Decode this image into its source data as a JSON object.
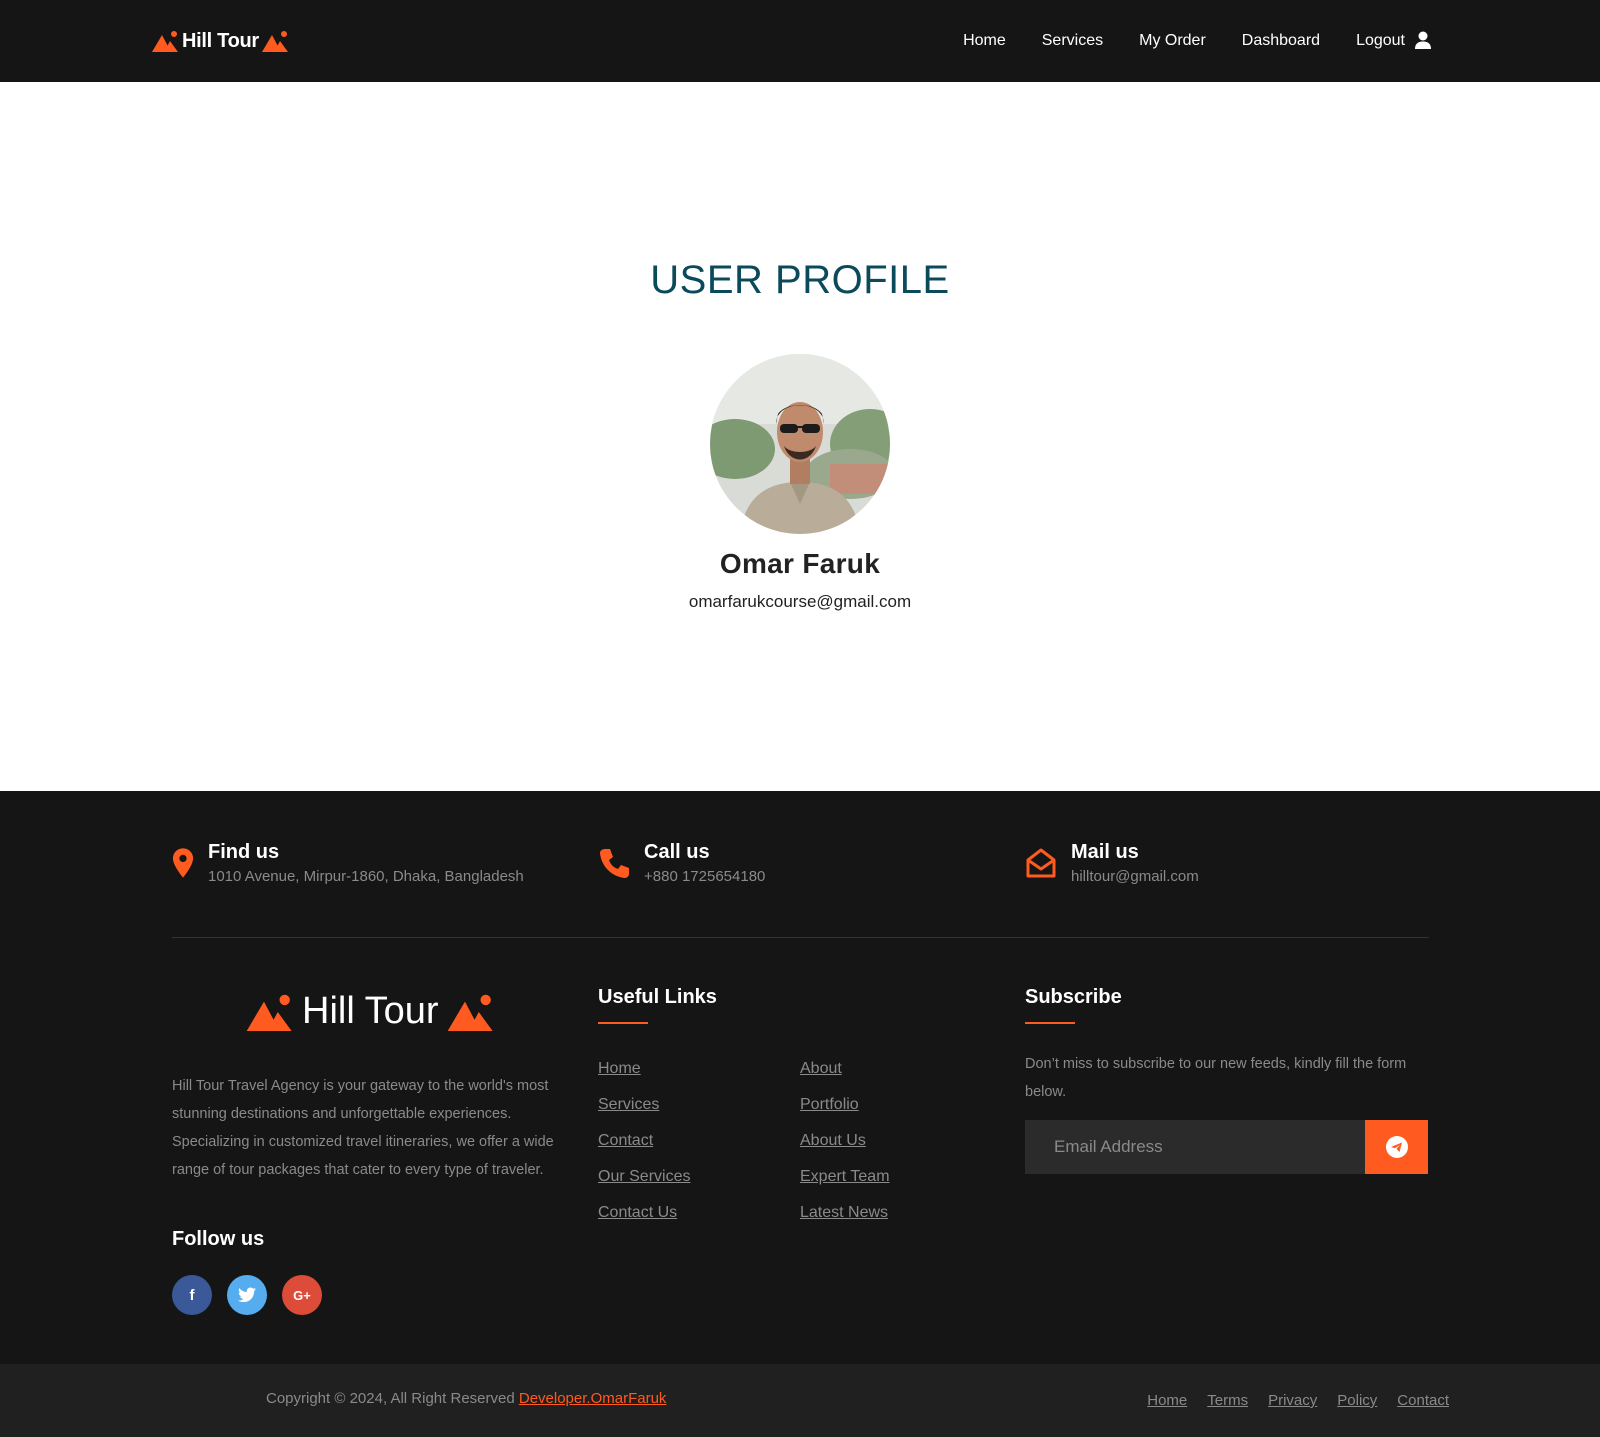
{
  "brand": {
    "name": "Hill Tour",
    "accent": "#ff5a1f",
    "logo_icon": "mountain-icon"
  },
  "nav": {
    "items": [
      {
        "label": "Home"
      },
      {
        "label": "Services"
      },
      {
        "label": "My Order"
      },
      {
        "label": "Dashboard"
      },
      {
        "label": "Logout"
      }
    ],
    "user_icon": "user-icon"
  },
  "profile": {
    "title": "USER PROFILE",
    "name": "Omar Faruk",
    "email": "omarfarukcourse@gmail.com",
    "avatar_icon": "avatar-photo"
  },
  "contact": {
    "find": {
      "title": "Find us",
      "text": "1010 Avenue, Mirpur-1860, Dhaka, Bangladesh",
      "icon": "map-pin-icon"
    },
    "call": {
      "title": "Call us",
      "text": "+880 1725654180",
      "icon": "phone-icon"
    },
    "mail": {
      "title": "Mail us",
      "text": "hilltour@gmail.com",
      "icon": "envelope-open-icon"
    }
  },
  "footer": {
    "logo_text": "Hill Tour",
    "about": "Hill Tour Travel Agency is your gateway to the world's most stunning destinations and unforgettable experiences. Specializing in customized travel itineraries, we offer a wide range of tour packages that cater to every type of traveler.",
    "follow_title": "Follow us",
    "socials": [
      {
        "label": "f",
        "icon": "facebook-icon",
        "color": "#3b5998"
      },
      {
        "label": "t",
        "icon": "twitter-icon",
        "color": "#55acee"
      },
      {
        "label": "G+",
        "icon": "google-plus-icon",
        "color": "#dd4b39"
      }
    ],
    "useful_links_title": "Useful Links",
    "links_left": [
      "Home",
      "Services",
      "Contact",
      "Our Services",
      "Contact Us"
    ],
    "links_right": [
      "About",
      "Portfolio",
      "About Us",
      "Expert Team",
      "Latest News"
    ],
    "subscribe_title": "Subscribe",
    "subscribe_text": "Don’t miss to subscribe to our new feeds, kindly fill the form below.",
    "email_placeholder": "Email Address",
    "send_icon": "telegram-send-icon"
  },
  "bottom": {
    "copyright": "Copyright © 2024, All Right Reserved ",
    "developer": "Developer.OmarFaruk",
    "links": [
      "Home",
      "Terms",
      "Privacy",
      "Policy",
      "Contact"
    ]
  }
}
